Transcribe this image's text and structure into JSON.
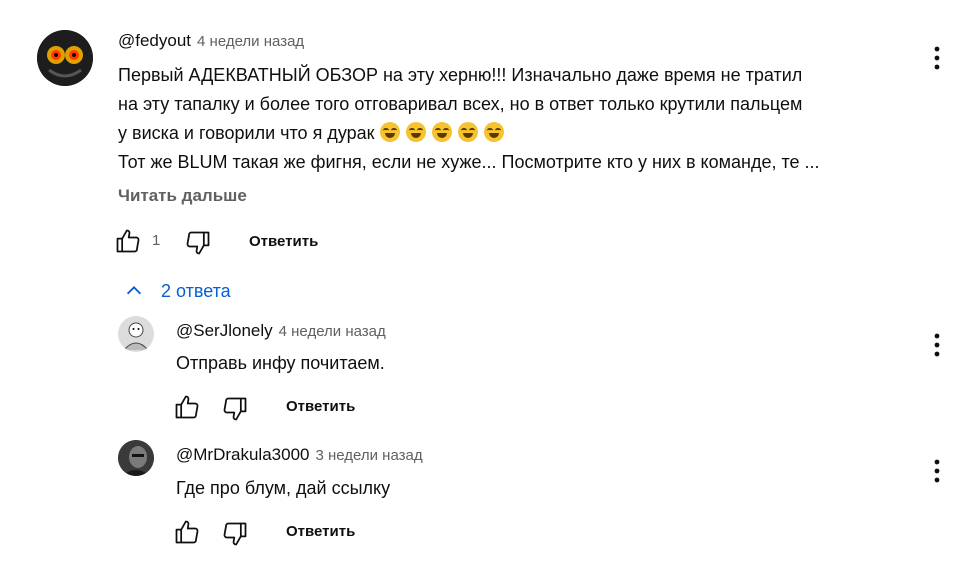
{
  "comment": {
    "author": "@fedyout",
    "time": "4 недели назад",
    "text_lines": [
      "Первый АДЕКВАТНЫЙ ОБЗОР на эту херню!!! Изначально даже время не тратил",
      "на эту тапалку и более того отговаривал всех, но в ответ только крутили пальцем",
      "у виска и говорили что я дурак",
      "Тот же BLUM такая же фигня, если не хуже... Посмотрите кто у них в команде, те ..."
    ],
    "read_more": "Читать дальше",
    "likes": "1",
    "reply_label": "Ответить"
  },
  "replies_toggle": {
    "label": "2 ответа"
  },
  "replies": [
    {
      "author": "@SerJlonely",
      "time": "4 недели назад",
      "text": "Отправь инфу почитаем.",
      "reply_label": "Ответить"
    },
    {
      "author": "@MrDrakula3000",
      "time": "3 недели назад",
      "text": "Где про блум, дай ссылку",
      "reply_label": "Ответить"
    }
  ],
  "icons": {
    "like": "thumb-up-icon",
    "dislike": "thumb-down-icon",
    "menu": "more-vert-icon",
    "collapse": "chevron-up-icon",
    "emoji": "rolling-on-floor-laughing-emoji"
  },
  "colors": {
    "link_blue": "#065fd4",
    "secondary": "#606060"
  }
}
